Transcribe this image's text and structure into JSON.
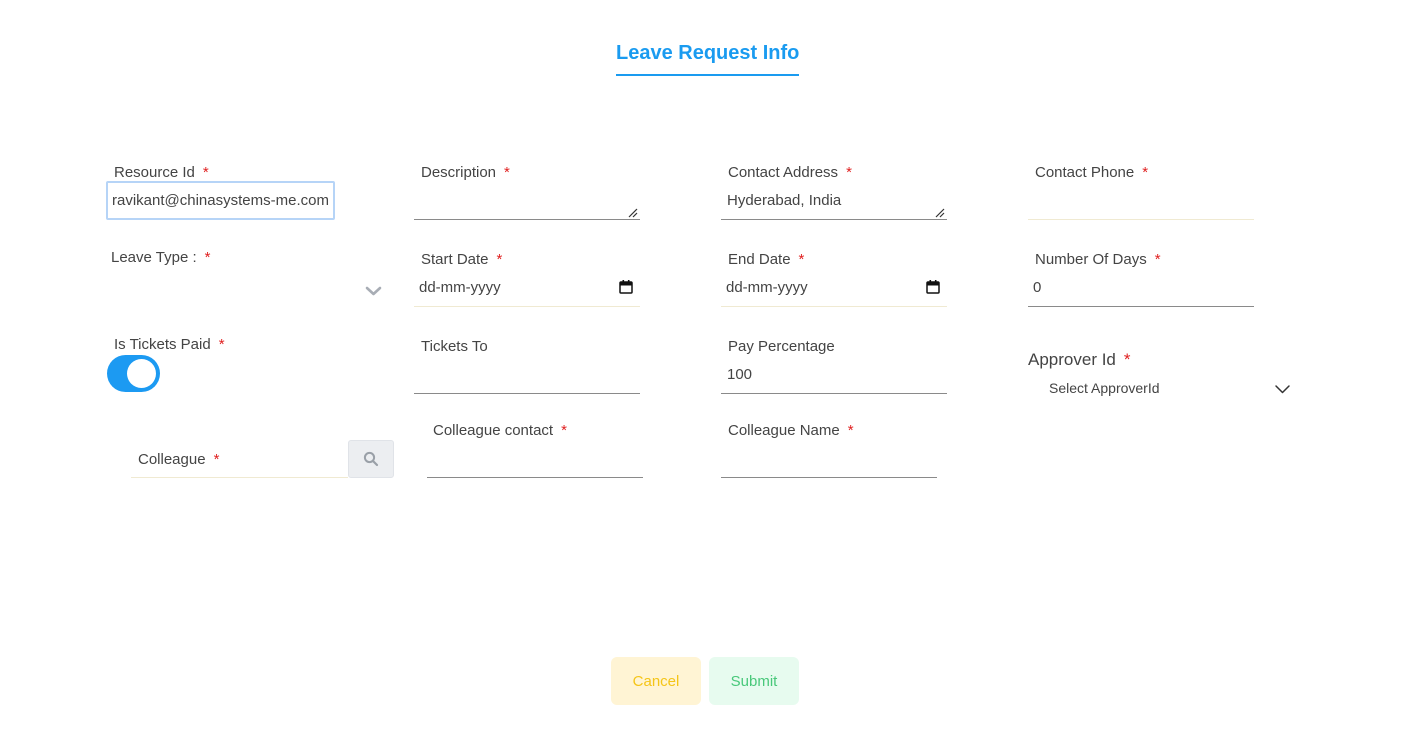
{
  "page": {
    "title": "Leave Request Info"
  },
  "fields": {
    "resource_id": {
      "label": "Resource Id",
      "value": "ravikant@chinasystems-me.com"
    },
    "description": {
      "label": "Description",
      "value": ""
    },
    "contact_address": {
      "label": "Contact Address",
      "value": "Hyderabad, India"
    },
    "contact_phone": {
      "label": "Contact Phone",
      "value": ""
    },
    "leave_type": {
      "label": "Leave Type :",
      "value": ""
    },
    "start_date": {
      "label": "Start Date",
      "placeholder": "dd-mm-yyyy"
    },
    "end_date": {
      "label": "End Date",
      "placeholder": "dd-mm-yyyy"
    },
    "number_of_days": {
      "label": "Number Of Days",
      "value": "0"
    },
    "is_tickets_paid": {
      "label": "Is Tickets Paid",
      "checked": true
    },
    "tickets_to": {
      "label": "Tickets To",
      "value": ""
    },
    "pay_percentage": {
      "label": "Pay Percentage",
      "value": "100"
    },
    "approver_id": {
      "label": "Approver Id",
      "placeholder": "Select ApproverId"
    },
    "colleague": {
      "label": "Colleague"
    },
    "colleague_contact": {
      "label": "Colleague contact"
    },
    "colleague_name": {
      "label": "Colleague Name"
    }
  },
  "required_marker": "*",
  "buttons": {
    "cancel": "Cancel",
    "submit": "Submit"
  },
  "colors": {
    "accent": "#1a9bf0",
    "required": "#e02020",
    "cancel": "#f5c518",
    "submit": "#48c87a"
  }
}
